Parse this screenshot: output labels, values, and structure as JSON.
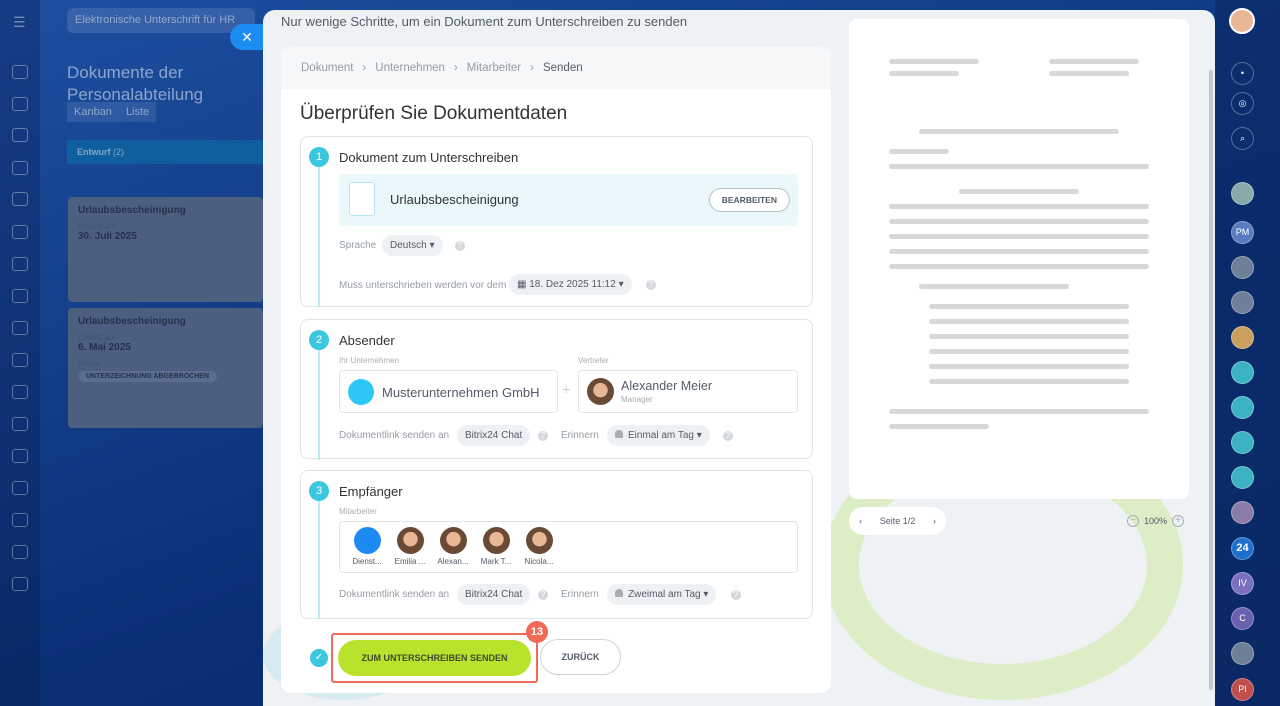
{
  "background": {
    "search": "Elektronische Unterschrift für HR",
    "title": "Dokumente der Personalabteilung",
    "tabs": [
      "Kanban",
      "Liste"
    ],
    "column": "Entwurf",
    "column_count": "(2)",
    "cards": [
      {
        "title": "Urlaubsbescheinigung",
        "label": "Erstellt am",
        "date": "30. Juli 2025"
      },
      {
        "title": "Urlaubsbescheinigung",
        "label": "Erstellt am",
        "date": "6. Mai 2025",
        "status_label": "Status",
        "status": "UNTERZEICHNUNG ABGEBROCHEN"
      }
    ]
  },
  "modal": {
    "title": "Nur wenige Schritte, um ein Dokument zum Unterschreiben zu senden",
    "breadcrumb": [
      "Dokument",
      "Unternehmen",
      "Mitarbeiter",
      "Senden"
    ],
    "heading": "Überprüfen Sie Dokumentdaten",
    "step1": {
      "num": "1",
      "title": "Dokument zum Unterschreiben",
      "doc": "Urlaubsbescheinigung",
      "edit": "BEARBEITEN",
      "lang_label": "Sprache",
      "lang": "Deutsch",
      "deadline_label": "Muss unterschrieben werden vor dem",
      "deadline": "18. Dez 2025 11:12"
    },
    "step2": {
      "num": "2",
      "title": "Absender",
      "company_label": "Ihr Unternehmen",
      "company": "Musterunternehmen GmbH",
      "rep_label": "Vertreter",
      "rep_name": "Alexander Meier",
      "rep_role": "Manager",
      "link_label": "Dokumentlink senden an",
      "link": "Bitrix24 Chat",
      "remind_label": "Erinnern",
      "remind": "Einmal am Tag"
    },
    "step3": {
      "num": "3",
      "title": "Empfänger",
      "emp_label": "Mitarbeiter",
      "employees": [
        "Dienst...",
        "Emilia ...",
        "Alexan...",
        "Mark T...",
        "Nicola..."
      ],
      "link_label": "Dokumentlink senden an",
      "link": "Bitrix24 Chat",
      "remind_label": "Erinnern",
      "remind": "Zweimal am Tag"
    },
    "send": "ZUM UNTERSCHREIBEN SENDEN",
    "back": "ZURÜCK",
    "step_badge": "13",
    "page": "Seite 1/2",
    "zoom": "100%"
  },
  "right_sidebar": {
    "avatars": [
      "PM",
      "24",
      "IV",
      "C",
      "PI"
    ]
  }
}
